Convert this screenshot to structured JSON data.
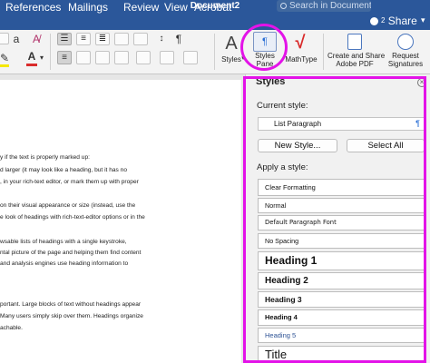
{
  "window": {
    "title": "Document2",
    "search_placeholder": "Search in Document"
  },
  "menu": {
    "tabs": [
      "References",
      "Mailings",
      "Review",
      "View",
      "Acrobat"
    ],
    "share_label": "Share",
    "share_badge": "2"
  },
  "ribbon": {
    "styles_label": "Styles",
    "styles_pane_label": [
      "Styles",
      "Pane"
    ],
    "mathtype_label": "MathType",
    "create_share_label": [
      "Create and Share",
      "Adobe PDF"
    ],
    "request_signatures_label": [
      "Request",
      "Signatures"
    ]
  },
  "document": {
    "lines": [
      "y if the text is properly marked up:",
      "d larger (it may look like a heading, but it has no",
      ", in your rich-text editor, or mark them up with proper",
      "",
      "on their visual appearance or size (instead, use the",
      "e look of headings with rich-text-editor options or in the",
      "",
      "wsable lists of headings with a single keystroke,",
      "ntal picture of the page and helping them find content",
      "and analysis engines use heading information to",
      "",
      "",
      "",
      "portant. Large blocks of text without headings appear",
      "Many users simply skip over them. Headings organize",
      "achable."
    ]
  },
  "styles_pane": {
    "title": "Styles",
    "current_style_label": "Current style:",
    "current_style_value": "List Paragraph",
    "new_style_button": "New Style...",
    "select_all_button": "Select All",
    "apply_label": "Apply a style:",
    "styles": [
      "Clear Formatting",
      "Normal",
      "Default Paragraph Font",
      "No Spacing",
      "Heading 1",
      "Heading 2",
      "Heading 3",
      "Heading 4",
      "Heading 5",
      "Title"
    ]
  },
  "colors": {
    "brand_blue": "#2b579a",
    "highlight_magenta": "#e313e8",
    "mathtype_red": "#d92b2b"
  }
}
